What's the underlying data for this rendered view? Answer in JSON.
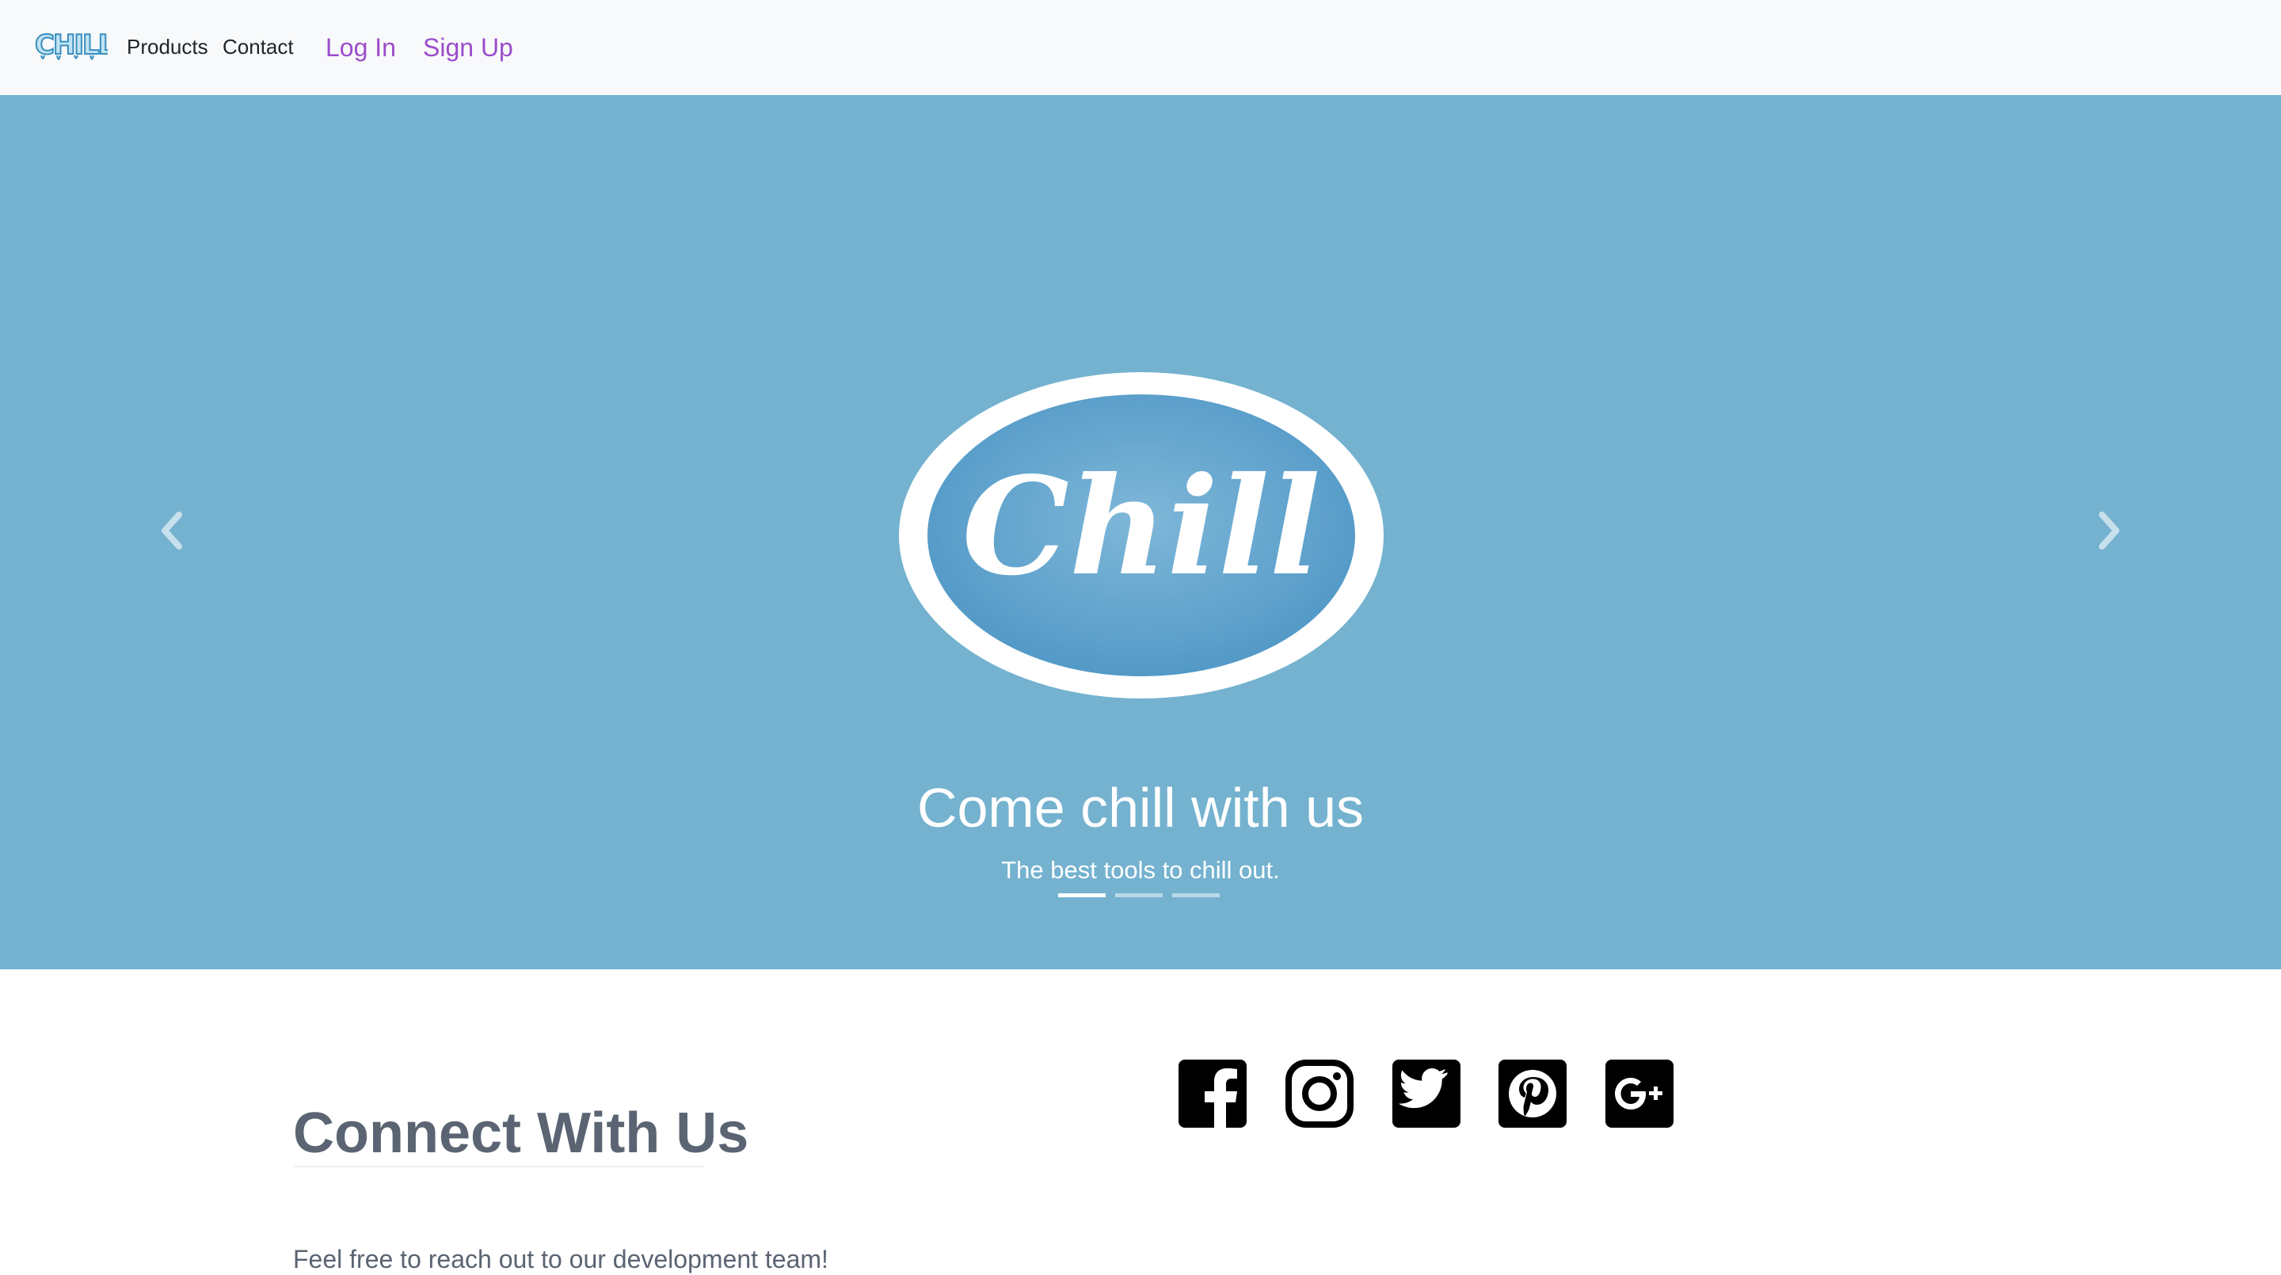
{
  "navbar": {
    "brand_logo_text": "CHILL",
    "products_label": "Products",
    "contact_label": "Contact",
    "login_label": "Log In",
    "signup_label": "Sign Up"
  },
  "carousel": {
    "logo_text": "Chill",
    "title": "Come chill with us",
    "text": "The best tools to chill out.",
    "slide_count": 3,
    "active_slide": 1,
    "prev_icon": "chevron-left-icon",
    "next_icon": "chevron-right-icon",
    "background_color": "#74b2cf"
  },
  "connect": {
    "heading": "Connect With Us",
    "text": "Feel free to reach out to our development team!",
    "social_icons": [
      "facebook-icon",
      "instagram-icon",
      "twitter-icon",
      "pinterest-icon",
      "google-plus-icon"
    ]
  },
  "colors": {
    "accent_link": "#9b4dca",
    "heading_text": "#5a6472",
    "navbar_bg": "#f8f9fa"
  }
}
